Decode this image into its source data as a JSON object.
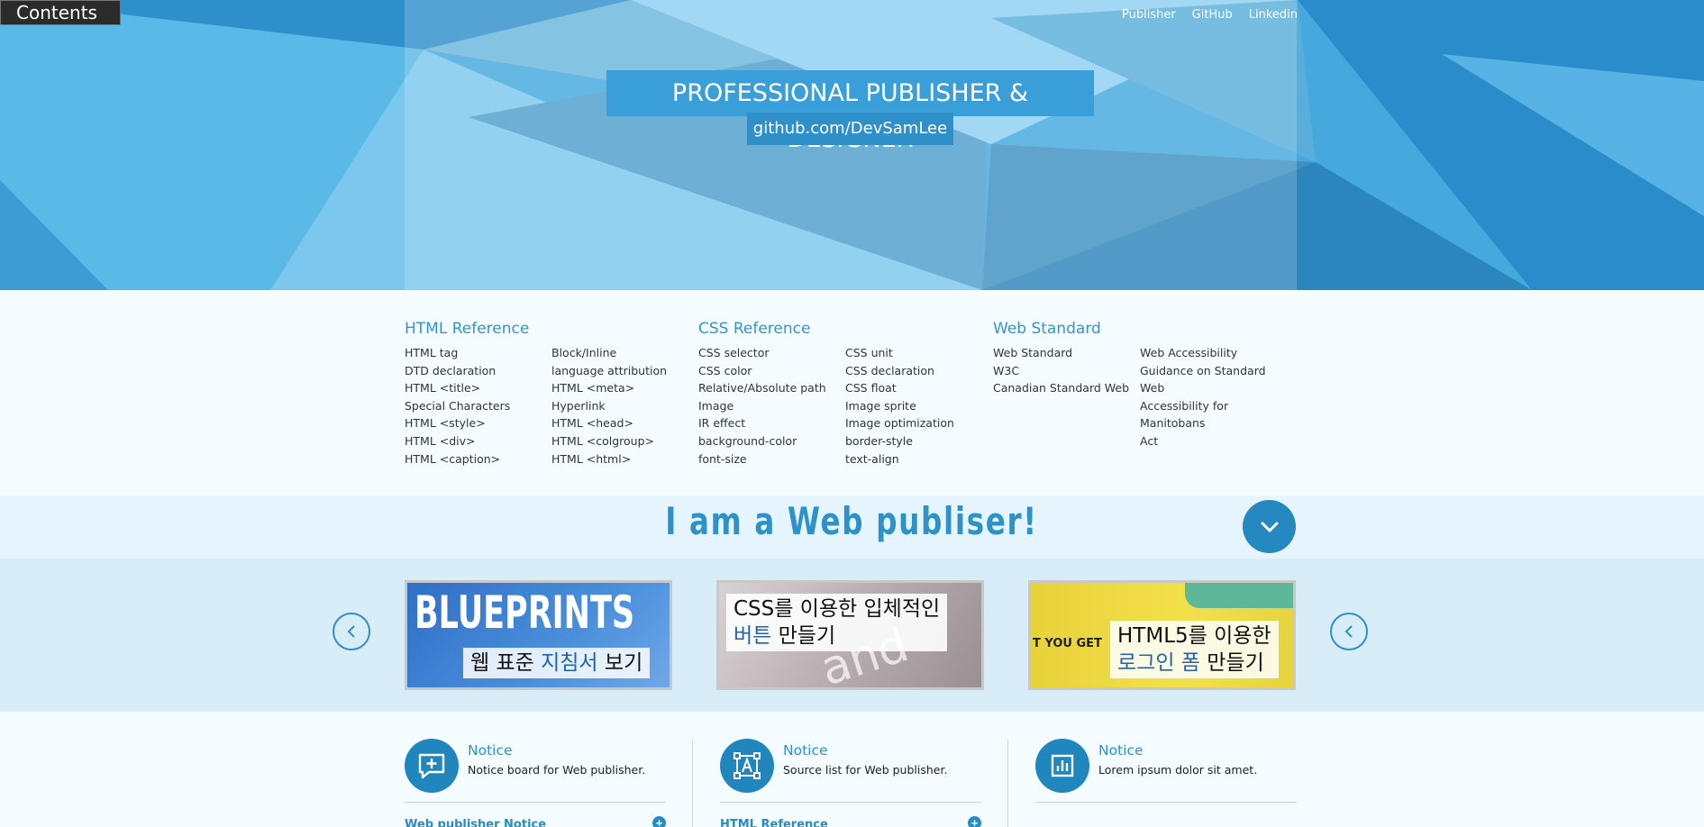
{
  "header": {
    "contents_label": "Contents",
    "nav": [
      "Publisher",
      "GitHub",
      "Linkedin"
    ],
    "title": "PROFESSIONAL PUBLISHER & DESIGNER",
    "subtitle": "github.com/DevSamLee"
  },
  "references": [
    {
      "title": "HTML Reference",
      "left": [
        "HTML tag",
        "DTD declaration",
        "HTML <title>",
        "Special Characters",
        "HTML <style>",
        "HTML <div>",
        "HTML <caption>"
      ],
      "right": [
        "Block/Inline",
        "language attribution",
        "HTML <meta>",
        "Hyperlink",
        "HTML <head>",
        "HTML <colgroup>",
        "HTML <html>"
      ]
    },
    {
      "title": "CSS Reference",
      "left": [
        "CSS selector",
        "CSS color",
        "Relative/Absolute path",
        "Image",
        "IR effect",
        "background-color",
        "font-size"
      ],
      "right": [
        "CSS unit",
        "CSS declaration",
        "CSS float",
        "Image sprite",
        "Image optimization",
        "border-style",
        "text-align"
      ]
    },
    {
      "title": "Web Standard",
      "left": [
        "Web Standard",
        "W3C",
        "Canadian Standard Web"
      ],
      "right": [
        "Web Accessibility",
        "Guidance on Standard Web",
        "Accessibility for Manitobans",
        "Act"
      ]
    }
  ],
  "banner": {
    "title": "I am a Web publiser!"
  },
  "slides": [
    {
      "big": "BLUEPRINTS",
      "line1_a": "웹 표준 ",
      "line1_hl": "지침서",
      "line1_b": " 보기"
    },
    {
      "line1": "CSS를 이용한 입체적인",
      "line2_hl": "버튼",
      "line2_b": " 만들기",
      "bg_text": "and inte"
    },
    {
      "line1": "HTML5를 이용한",
      "line2_hl": "로그인 폼",
      "line2_b": " 만들기",
      "bg_text": "T YOU GET"
    }
  ],
  "notices": [
    {
      "title": "Notice",
      "desc": "Notice board for Web publisher.",
      "link": "Web publisher Notice",
      "icon": "message-add-icon"
    },
    {
      "title": "Notice",
      "desc": "Source list for Web publisher.",
      "link": "HTML Reference",
      "icon": "text-box-icon"
    },
    {
      "title": "Notice",
      "desc": "Lorem ipsum dolor sit amet.",
      "link": "",
      "icon": "bar-chart-icon"
    }
  ],
  "colors": {
    "accent": "#2a93cd",
    "hero": "#3fa3dc",
    "dark_button": "#2b2b2b"
  }
}
